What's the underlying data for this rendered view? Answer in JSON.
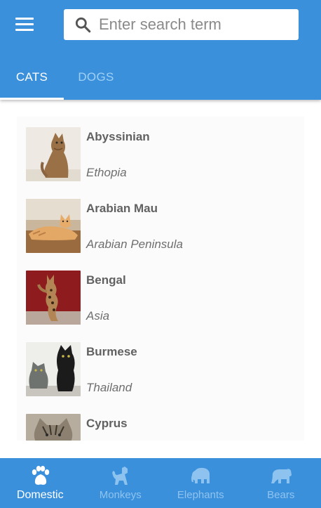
{
  "search": {
    "placeholder": "Enter search term",
    "value": ""
  },
  "tabs": [
    {
      "label": "CATS",
      "selected": true
    },
    {
      "label": "DOGS",
      "selected": false
    }
  ],
  "breeds": [
    {
      "name": "Abyssinian",
      "origin": "Ethopia"
    },
    {
      "name": "Arabian Mau",
      "origin": "Arabian Peninsula"
    },
    {
      "name": "Bengal",
      "origin": "Asia"
    },
    {
      "name": "Burmese",
      "origin": "Thailand"
    },
    {
      "name": "Cyprus",
      "origin": ""
    }
  ],
  "bottom_nav": [
    {
      "label": "Domestic",
      "icon": "paw-icon",
      "selected": true
    },
    {
      "label": "Monkeys",
      "icon": "monkey-icon",
      "selected": false
    },
    {
      "label": "Elephants",
      "icon": "elephant-icon",
      "selected": false
    },
    {
      "label": "Bears",
      "icon": "bear-icon",
      "selected": false
    }
  ],
  "colors": {
    "primary": "#3b90dc",
    "tab_inactive": "#9fd0f5",
    "nav_inactive": "#8fc3ef"
  }
}
